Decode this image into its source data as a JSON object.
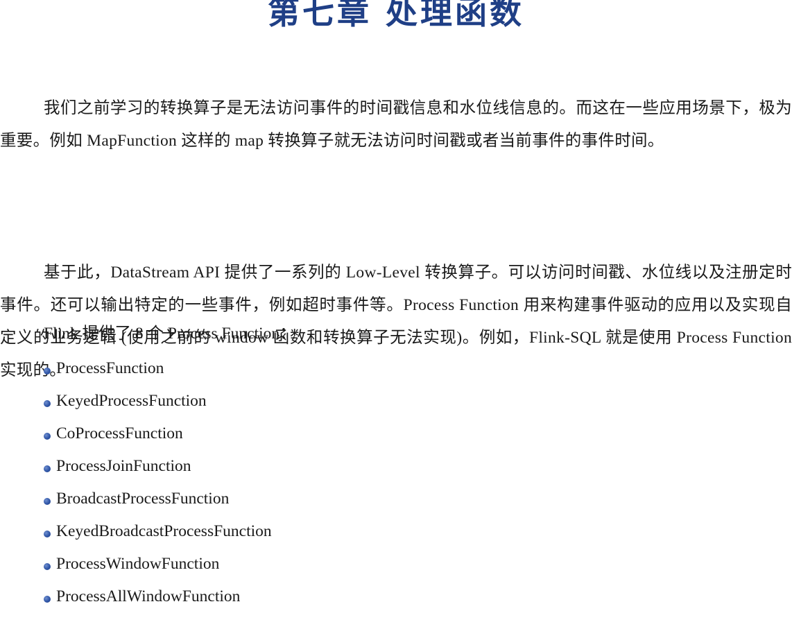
{
  "chapter": {
    "title": "第七章 处理函数"
  },
  "paragraphs": [
    "我们之前学习的转换算子是无法访问事件的时间戳信息和水位线信息的。而这在一些应用场景下，极为重要。例如 MapFunction 这样的 map 转换算子就无法访问时间戳或者当前事件的事件时间。",
    "基于此，DataStream API 提供了一系列的 Low-Level 转换算子。可以访问时间戳、水位线以及注册定时事件。还可以输出特定的一些事件，例如超时事件等。Process Function 用来构建事件驱动的应用以及实现自定义的业务逻辑 (使用之前的 window 函数和转换算子无法实现)。例如，Flink-SQL 就是使用 Process Function 实现的。"
  ],
  "intro": "Flink 提供了 8 个 Process Function：",
  "functions": [
    "ProcessFunction",
    "KeyedProcessFunction",
    "CoProcessFunction",
    "ProcessJoinFunction",
    "BroadcastProcessFunction",
    "KeyedBroadcastProcessFunction",
    "ProcessWindowFunction",
    "ProcessAllWindowFunction"
  ],
  "colors": {
    "title": "#1f3f86",
    "bullet": "#2f55a6",
    "text": "#1a1a1a"
  },
  "icons": {
    "bullet": "bullet-icon"
  }
}
